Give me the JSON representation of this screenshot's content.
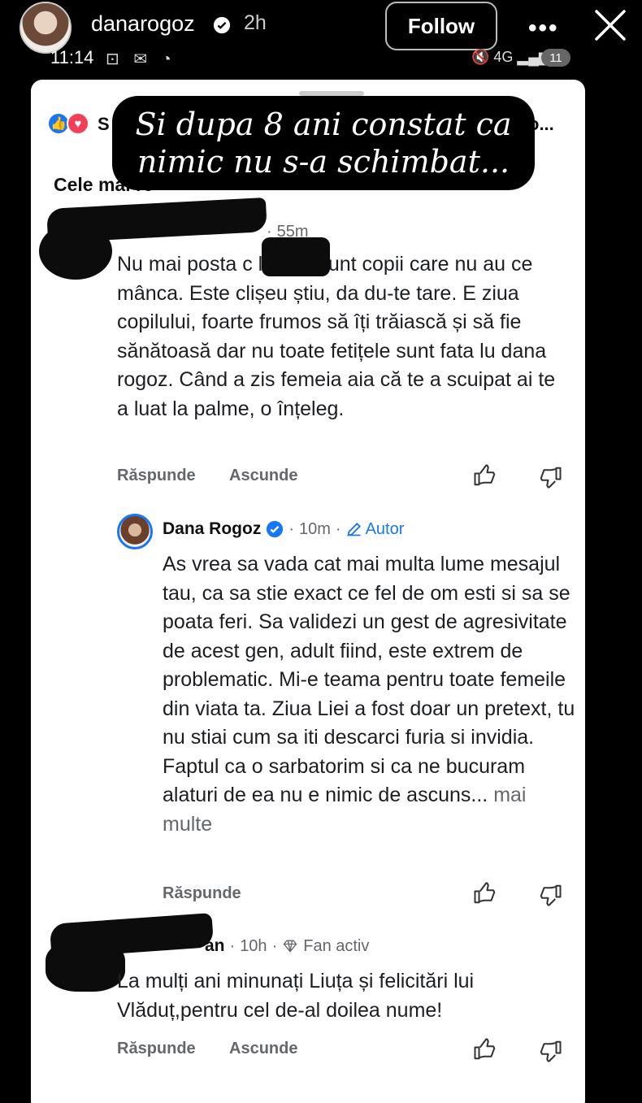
{
  "story": {
    "username": "danarogoz",
    "time_ago": "2h",
    "follow_label": "Follow",
    "more_label": "•••"
  },
  "status_bar": {
    "time": "11:14",
    "left_icons": "⊡ ✉ ◔",
    "right_icons": "🔇 4G ▂▄▆",
    "battery": "11"
  },
  "card": {
    "reaction_text": "S",
    "reaction_trailing": "o...",
    "sort_label": "Cele mai re"
  },
  "caption": {
    "line1": "Si dupa 8 ani constat ca",
    "line2": "nimic nu s-a schimbat..."
  },
  "comments": [
    {
      "time": "55m",
      "text": "Nu mai posta c        l asta, sunt copii care nu au ce mânca. Este clișeu știu, da du-te tare. E ziua copilului, foarte frumos să îți trăiască și să fie sănătoasă dar nu toate fetițele sunt fata lu dana rogoz. Când a zis femeia aia că te a scuipat ai te a luat la palme, o înțeleg.",
      "reply_label": "Răspunde",
      "hide_label": "Ascunde"
    },
    {
      "name": "Dana Rogoz",
      "time": "10m",
      "author_label": "Autor",
      "text": "As vrea sa vada cat mai multa lume mesajul tau, ca sa stie exact ce fel de om esti si sa se poata feri. Sa validezi un gest de agresivitate de acest gen, adult fiind, este extrem de problematic. Mi-e teama pentru toate femeile din viata ta. Ziua Liei a fost doar un pretext, tu nu stiai cum sa iti descarci furia si invidia. Faptul ca o sarbatorim si ca ne bucuram alaturi de ea nu e nimic de ascuns...",
      "more_label": "mai multe",
      "reply_label": "Răspunde"
    },
    {
      "name_fragment": "an",
      "time": "10h",
      "badge": "Fan activ",
      "text": "La mulți ani minunați Liuța și felicitări lui Vlăduț,pentru cel de-al doilea nume!",
      "reply_label": "Răspunde",
      "hide_label": "Ascunde"
    }
  ]
}
